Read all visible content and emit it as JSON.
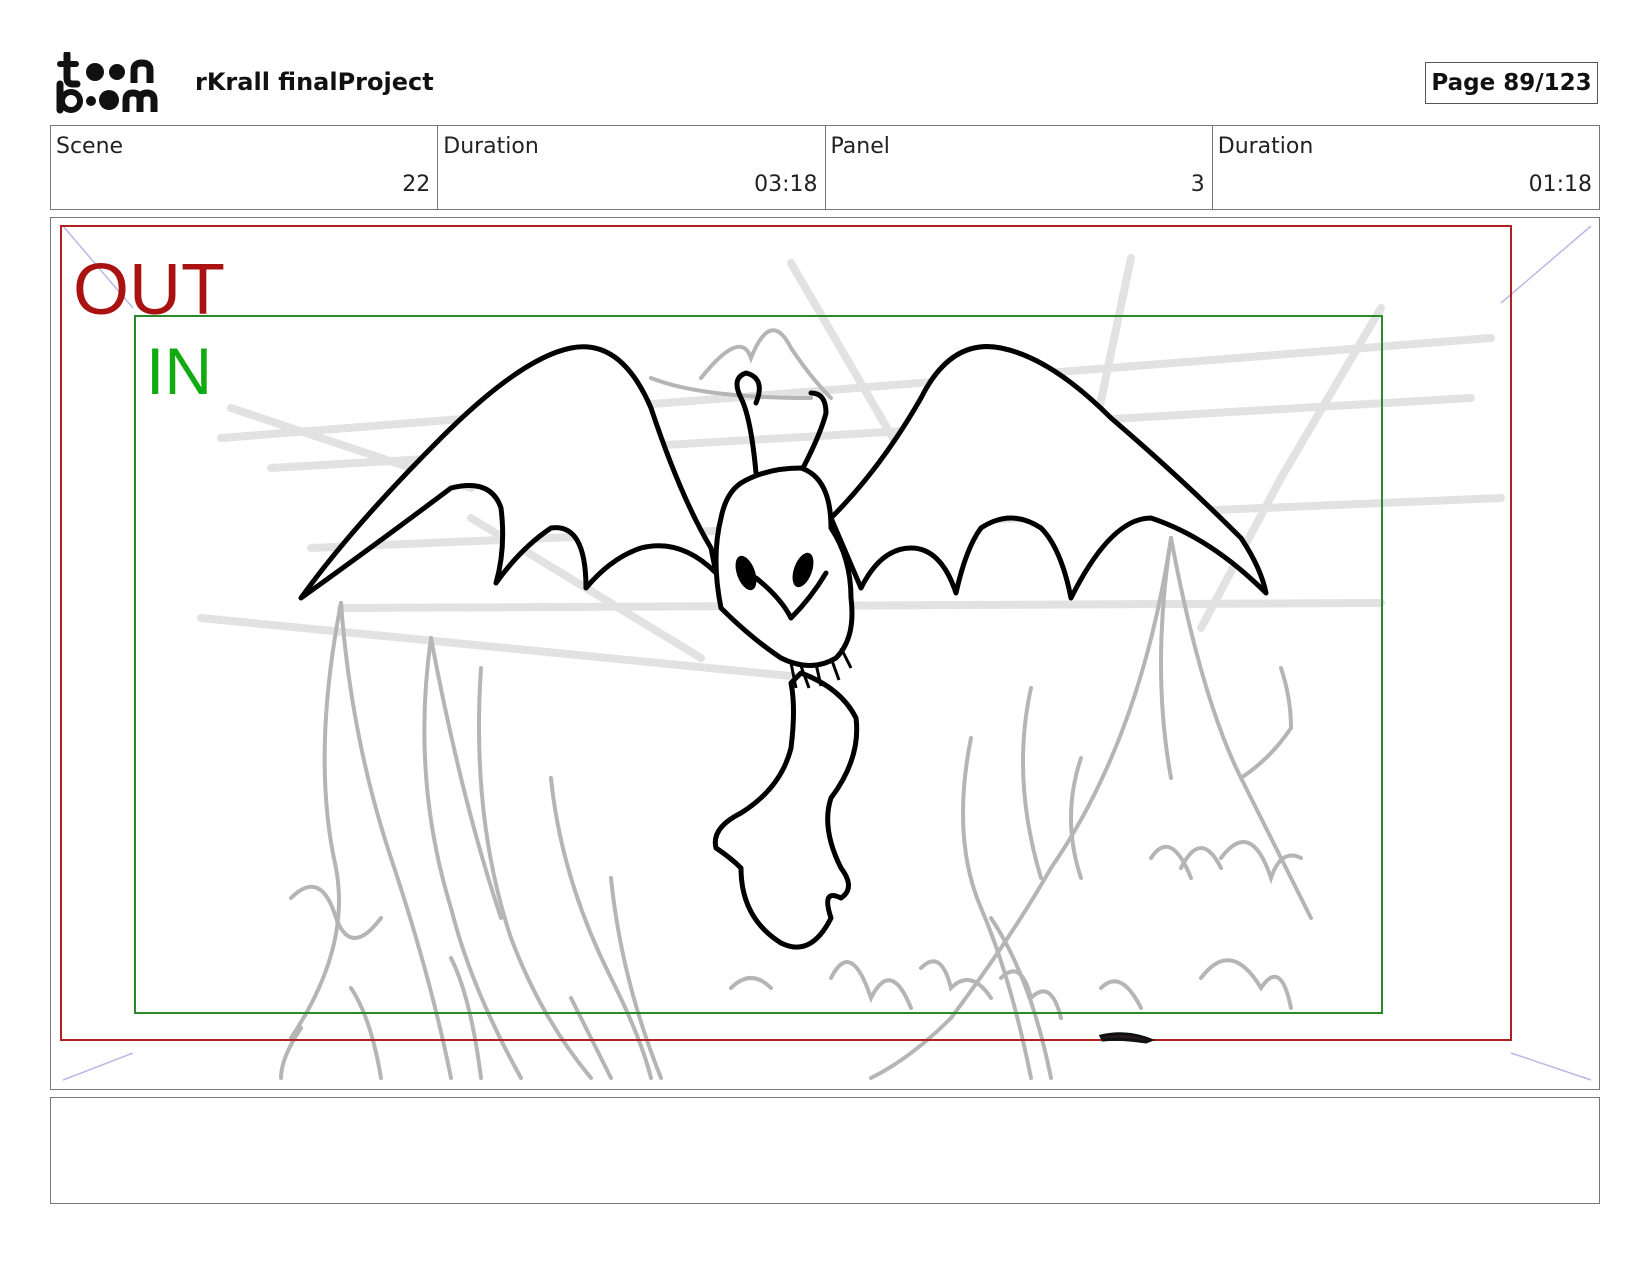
{
  "header": {
    "logo_text": "toon boom",
    "project_title": "rKrall finalProject",
    "page_label": "Page",
    "page_value": "89/123"
  },
  "info": {
    "scene_label": "Scene",
    "scene_value": "22",
    "scene_duration_label": "Duration",
    "scene_duration_value": "03:18",
    "panel_label": "Panel",
    "panel_value": "3",
    "panel_duration_label": "Duration",
    "panel_duration_value": "01:18"
  },
  "frame": {
    "out_label": "OUT",
    "in_label": "IN",
    "out_color": "#aa1111",
    "in_color": "#11aa11"
  },
  "caption": {
    "text": ""
  }
}
